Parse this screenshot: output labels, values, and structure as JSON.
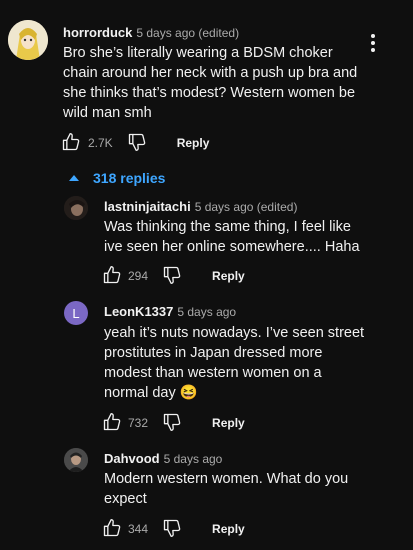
{
  "comment": {
    "author": "horrorduck",
    "time": "5 days ago (edited)",
    "text_lines": [
      "Bro she’s literally wearing a BDSM choker",
      "chain around her neck with a push up bra and",
      "she thinks that’s modest? Western women be",
      "wild man smh"
    ],
    "likes": "2.7K",
    "reply_label": "Reply"
  },
  "replies_toggle": "318 replies",
  "replies": [
    {
      "author": "lastninjaitachi",
      "time": "5 days ago (edited)",
      "text_lines": [
        "Was thinking the same thing, I feel like",
        "ive seen her online somewhere.... Haha"
      ],
      "likes": "294",
      "reply_label": "Reply"
    },
    {
      "author": "LeonK1337",
      "avatar_letter": "L",
      "time": "5 days ago",
      "text_lines": [
        "yeah it’s nuts nowadays. I’ve seen street",
        "prostitutes in Japan dressed more",
        "modest than western women on a",
        "normal day 😆"
      ],
      "likes": "732",
      "reply_label": "Reply"
    },
    {
      "author": "Dahvood",
      "time": "5 days ago",
      "text_lines": [
        "Modern western women. What do you",
        "expect"
      ],
      "likes": "344",
      "reply_label": "Reply"
    }
  ],
  "colors": {
    "background": "#0f0f0f",
    "link_blue": "#3ea6ff",
    "avatar_purple": "#7b68c4",
    "muted": "#aaaaaa"
  }
}
